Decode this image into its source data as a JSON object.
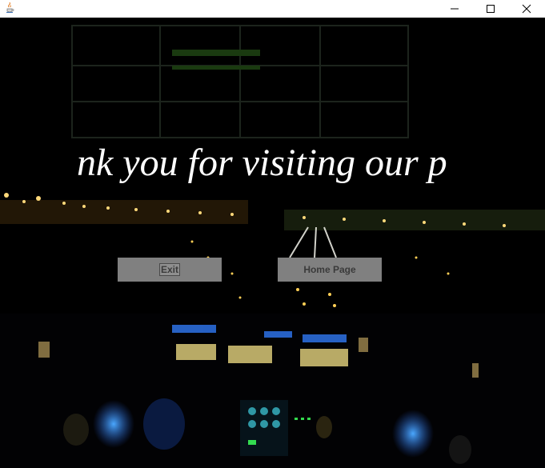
{
  "titlebar": {
    "app_icon": "java-coffee-cup-icon",
    "minimize_icon": "minimize-icon",
    "maximize_icon": "maximize-icon",
    "close_icon": "close-icon"
  },
  "main": {
    "message": "nk you for visiting our p",
    "exit_label": "Exit",
    "home_label": "Home Page",
    "background": "night airplane cockpit view of runway lights",
    "colors": {
      "button_bg": "#808080",
      "button_text": "#3a3a3a",
      "message_text": "#ffffff",
      "scene_bg": "#000000"
    }
  }
}
